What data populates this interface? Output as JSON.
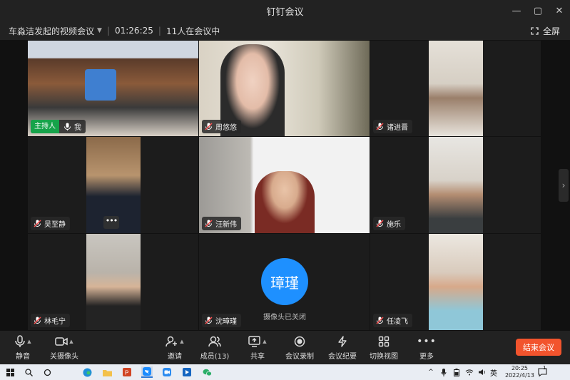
{
  "window": {
    "title": "钉钉会议",
    "controls": [
      "—",
      "▢",
      "✕"
    ]
  },
  "infobar": {
    "meeting_name": "车淼洁发起的视频会议",
    "duration": "01:26:25",
    "participants_text": "11人在会议中",
    "fullscreen_label": "全屏"
  },
  "participants": [
    {
      "name": "我",
      "host_label": "主持人"
    },
    {
      "name": "周悠悠"
    },
    {
      "name": "诸进晋"
    },
    {
      "name": "吴至静",
      "more": "•••"
    },
    {
      "name": "汪新伟"
    },
    {
      "name": "施乐"
    },
    {
      "name": "林毛宁"
    },
    {
      "name": "沈璋瑾",
      "avatar_text": "璋瑾",
      "camera_off_text": "摄像头已关闭"
    },
    {
      "name": "任凌飞"
    }
  ],
  "toolbar": {
    "mute": "静音",
    "camera_off": "关摄像头",
    "invite": "邀请",
    "members": "成员(13)",
    "share": "共享",
    "record": "会议录制",
    "minutes": "会议纪要",
    "switch_view": "切换视图",
    "more": "更多",
    "end_meeting": "结束会议"
  },
  "taskbar": {
    "time": "20:25",
    "date": "2022/4/13",
    "ime": "英",
    "notification_count": "1"
  },
  "colors": {
    "accent_blue": "#1e90ff",
    "end_red": "#f2542d",
    "host_green": "#16a34a"
  }
}
